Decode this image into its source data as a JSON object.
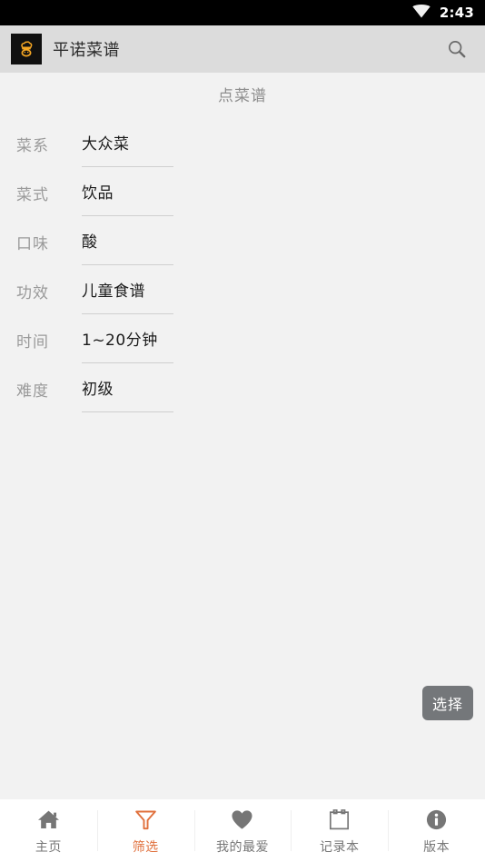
{
  "status_bar": {
    "time": "2:43",
    "wifi_icon": "wifi-icon",
    "background_color": "#000000"
  },
  "header": {
    "app_title": "平诺菜谱",
    "logo_icon": "app-logo-chef-icon",
    "search_icon": "search-icon",
    "background_color": "#dcdcdc"
  },
  "main": {
    "page_title": "点菜谱",
    "fields": [
      {
        "label": "菜系",
        "value": "大众菜"
      },
      {
        "label": "菜式",
        "value": "饮品"
      },
      {
        "label": "口味",
        "value": "酸"
      },
      {
        "label": "功效",
        "value": "儿童食谱"
      },
      {
        "label": "时间",
        "value": "1~20分钟"
      },
      {
        "label": "难度",
        "value": "初级"
      }
    ],
    "select_button": "选择",
    "background_color": "#f2f2f2"
  },
  "bottom_nav": {
    "active_color": "#e0703c",
    "inactive_color": "#767676",
    "items": [
      {
        "label": "主页",
        "icon": "home-icon",
        "active": false
      },
      {
        "label": "筛选",
        "icon": "filter-funnel-icon",
        "active": true
      },
      {
        "label": "我的最爱",
        "icon": "heart-icon",
        "active": false
      },
      {
        "label": "记录本",
        "icon": "clipboard-icon",
        "active": false
      },
      {
        "label": "版本",
        "icon": "info-icon",
        "active": false
      }
    ]
  }
}
